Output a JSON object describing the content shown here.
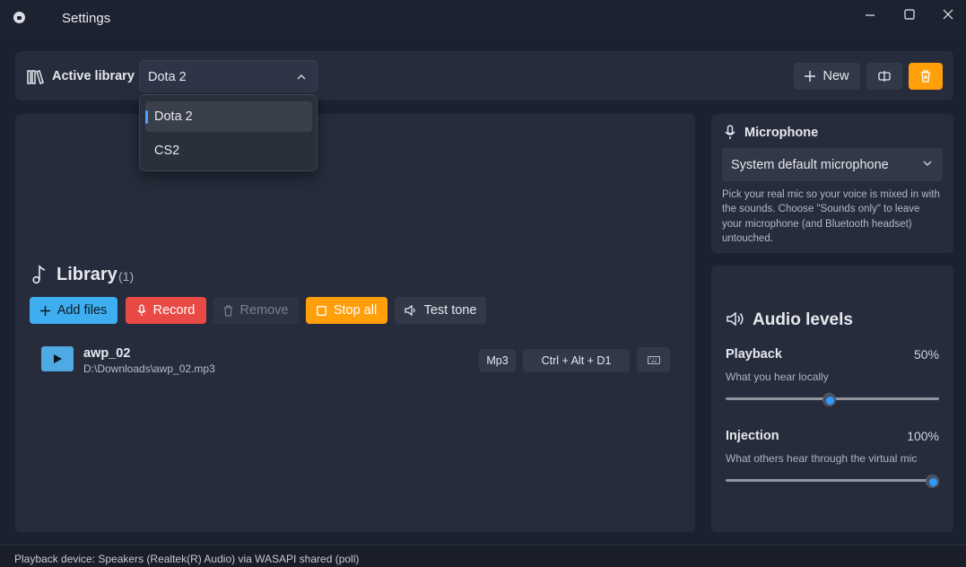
{
  "window": {
    "title": "Settings",
    "app_icon": "app-icon",
    "controls": [
      "minimize-icon",
      "maximize-icon",
      "close-icon"
    ]
  },
  "toolbar": {
    "active_library_label": "Active library",
    "library_icon": "library-icon",
    "selected_library": "Dota 2",
    "dropdown_open": true,
    "options": [
      "Dota 2",
      "CS2"
    ],
    "new_label": "New",
    "rename_icon": "rename-icon",
    "delete_icon": "trash-icon"
  },
  "library": {
    "heading": "Library",
    "count": "(1)",
    "actions": {
      "add_files": "Add files",
      "record": "Record",
      "remove": "Remove",
      "stop_all": "Stop all",
      "test_tone": "Test tone"
    },
    "tracks": [
      {
        "name": "awp_02",
        "path": "D:\\Downloads\\awp_02.mp3",
        "format": "Mp3",
        "hotkey": "Ctrl + Alt + D1",
        "keyboard_icon": "keyboard-icon"
      }
    ]
  },
  "microphone": {
    "title": "Microphone",
    "selected": "System default microphone",
    "help": "Pick your real mic so your voice is mixed in with the sounds. Choose \"Sounds only\" to leave your microphone (and Bluetooth headset) untouched."
  },
  "audio_levels": {
    "title": "Audio levels",
    "playback": {
      "label": "Playback",
      "value_text": "50%",
      "value": 50,
      "description": "What you hear locally"
    },
    "injection": {
      "label": "Injection",
      "value_text": "100%",
      "value": 100,
      "description": "What others hear through the virtual mic"
    }
  },
  "status": {
    "text": "Playback device: Speakers (Realtek(R) Audio) via WASAPI shared (poll)"
  },
  "colors": {
    "accent": "#2f9bff",
    "add_files": "#3eaef0",
    "record": "#ea4a45",
    "stop_all": "#ff9f0a",
    "delete": "#ff9f0a"
  }
}
